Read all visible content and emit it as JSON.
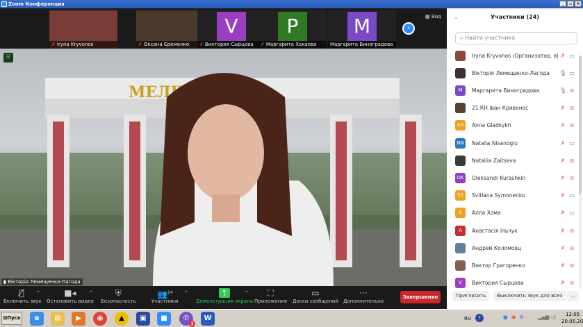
{
  "window": {
    "title": "Zoom Конференция"
  },
  "strip": {
    "view_label": "Вид",
    "thumbs": [
      {
        "name": "Iryna Kryvonos",
        "muted": true,
        "initial": "",
        "color": "#7a3c36"
      },
      {
        "name": "Оксана Єременко",
        "muted": true,
        "initial": "",
        "color": "#4a3a2c"
      },
      {
        "name": "Виктория Сырцова",
        "muted": true,
        "initial": "V",
        "color": "#9b3fc2"
      },
      {
        "name": "Маргарита Хахаева",
        "muted": true,
        "initial": "P",
        "color": "#2f7a23"
      },
      {
        "name": "Маргарита Виноградова",
        "muted": false,
        "initial": "M",
        "color": "#7b48c8"
      }
    ]
  },
  "main": {
    "speaker": "Вікторія Лемещенко-Лагода",
    "sign_text": "МЕЛІТОПОЛЬ"
  },
  "toolbar": {
    "unmute": "Включить звук",
    "stop_video": "Остановить видео",
    "security": "Безопасность",
    "participants": "Участники",
    "participants_count": "24",
    "share": "Демонстрация экрана",
    "apps": "Приложения",
    "whiteboards": "Доски сообщений",
    "more": "Дополнительно",
    "end": "Завершение"
  },
  "panel": {
    "title": "Участники (24)",
    "search_placeholder": "Найти участника",
    "invite": "Пригласить",
    "mute_all": "Выключить звук для всех",
    "more": "...",
    "participants": [
      {
        "name": "Iryna Kryvonos (Организатор, я)",
        "avatar": "",
        "color": "#8a4a3a",
        "mic": "muted",
        "cam": "on"
      },
      {
        "name": "Вікторія Лемещенко-Лагода",
        "avatar": "",
        "color": "#3a3030",
        "mic": "on",
        "cam": "on"
      },
      {
        "name": "Маргарита Виноградова",
        "avatar": "M",
        "color": "#7b48c8",
        "mic": "on",
        "cam": "off"
      },
      {
        "name": "21 КН Іван Кривонос",
        "avatar": "",
        "color": "#5a4030",
        "mic": "muted",
        "cam": "off"
      },
      {
        "name": "Anna Gladkykh",
        "avatar": "AG",
        "color": "#f0a020",
        "mic": "muted",
        "cam": "off"
      },
      {
        "name": "Natalia Nisanoglu",
        "avatar": "NN",
        "color": "#2a7ac0",
        "mic": "muted",
        "cam": "on"
      },
      {
        "name": "Nataliia Zaitseva",
        "avatar": "",
        "color": "#3a3a3a",
        "mic": "muted",
        "cam": "off"
      },
      {
        "name": "Oleksandr Kurashkin",
        "avatar": "OK",
        "color": "#9040c0",
        "mic": "muted",
        "cam": "off"
      },
      {
        "name": "Svitlana Symonenko",
        "avatar": "SS",
        "color": "#f0a020",
        "mic": "muted",
        "cam": "on"
      },
      {
        "name": "Алла Хома",
        "avatar": "A",
        "color": "#f0a020",
        "mic": "muted",
        "cam": "on"
      },
      {
        "name": "Анастасія Ільчук",
        "avatar": "A",
        "color": "#c03030",
        "mic": "muted",
        "cam": "off"
      },
      {
        "name": "Андрей Коломоец",
        "avatar": "",
        "color": "#6080a0",
        "mic": "muted",
        "cam": "off"
      },
      {
        "name": "Виктор Григоренко",
        "avatar": "",
        "color": "#806050",
        "mic": "muted",
        "cam": "off"
      },
      {
        "name": "Виктория Сырцова",
        "avatar": "V",
        "color": "#9b3fc2",
        "mic": "muted",
        "cam": "off"
      }
    ]
  },
  "taskbar": {
    "start": "Пуск",
    "lang": "RU",
    "time": "12:05",
    "date": "20.05.2022",
    "viber_badge": "1"
  }
}
